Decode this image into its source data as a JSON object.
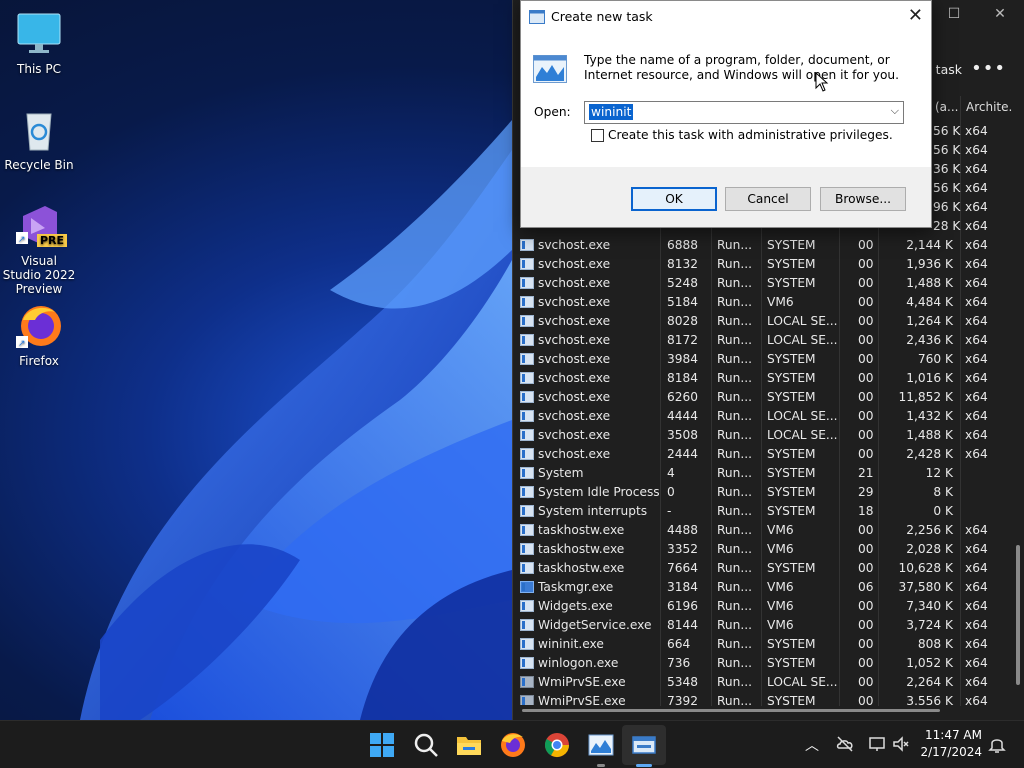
{
  "desktop": {
    "icons": [
      {
        "label": "This PC",
        "icon": "monitor-icon"
      },
      {
        "label": "Recycle Bin",
        "icon": "recycle-bin-icon"
      },
      {
        "label": "Visual Studio 2022 Preview",
        "badge": "PRE",
        "icon": "visual-studio-icon"
      },
      {
        "label": "Firefox",
        "icon": "firefox-icon"
      }
    ]
  },
  "taskmgr": {
    "run_task_label": "d task",
    "more_label": "•••",
    "columns": {
      "memory": "(a...",
      "arch": "Archite."
    },
    "partial_rows": [
      {
        "mem": "56 K",
        "arch": "x64"
      },
      {
        "mem": "56 K",
        "arch": "x64"
      },
      {
        "mem": "36 K",
        "arch": "x64"
      },
      {
        "mem": "56 K",
        "arch": "x64"
      },
      {
        "mem": "96 K",
        "arch": "x64"
      },
      {
        "mem": "28 K",
        "arch": "x64"
      }
    ],
    "rows": [
      {
        "name": "svchost.exe",
        "pid": "6888",
        "status": "Run...",
        "user": "SYSTEM",
        "cpu": "00",
        "mem": "2,144 K",
        "arch": "x64",
        "icon": "default"
      },
      {
        "name": "svchost.exe",
        "pid": "8132",
        "status": "Run...",
        "user": "SYSTEM",
        "cpu": "00",
        "mem": "1,936 K",
        "arch": "x64",
        "icon": "default"
      },
      {
        "name": "svchost.exe",
        "pid": "5248",
        "status": "Run...",
        "user": "SYSTEM",
        "cpu": "00",
        "mem": "1,488 K",
        "arch": "x64",
        "icon": "default"
      },
      {
        "name": "svchost.exe",
        "pid": "5184",
        "status": "Run...",
        "user": "VM6",
        "cpu": "00",
        "mem": "4,484 K",
        "arch": "x64",
        "icon": "default"
      },
      {
        "name": "svchost.exe",
        "pid": "8028",
        "status": "Run...",
        "user": "LOCAL SE...",
        "cpu": "00",
        "mem": "1,264 K",
        "arch": "x64",
        "icon": "default"
      },
      {
        "name": "svchost.exe",
        "pid": "8172",
        "status": "Run...",
        "user": "LOCAL SE...",
        "cpu": "00",
        "mem": "2,436 K",
        "arch": "x64",
        "icon": "default"
      },
      {
        "name": "svchost.exe",
        "pid": "3984",
        "status": "Run...",
        "user": "SYSTEM",
        "cpu": "00",
        "mem": "760 K",
        "arch": "x64",
        "icon": "default"
      },
      {
        "name": "svchost.exe",
        "pid": "8184",
        "status": "Run...",
        "user": "SYSTEM",
        "cpu": "00",
        "mem": "1,016 K",
        "arch": "x64",
        "icon": "default"
      },
      {
        "name": "svchost.exe",
        "pid": "6260",
        "status": "Run...",
        "user": "SYSTEM",
        "cpu": "00",
        "mem": "11,852 K",
        "arch": "x64",
        "icon": "default"
      },
      {
        "name": "svchost.exe",
        "pid": "4444",
        "status": "Run...",
        "user": "LOCAL SE...",
        "cpu": "00",
        "mem": "1,432 K",
        "arch": "x64",
        "icon": "default"
      },
      {
        "name": "svchost.exe",
        "pid": "3508",
        "status": "Run...",
        "user": "LOCAL SE...",
        "cpu": "00",
        "mem": "1,488 K",
        "arch": "x64",
        "icon": "default"
      },
      {
        "name": "svchost.exe",
        "pid": "2444",
        "status": "Run...",
        "user": "SYSTEM",
        "cpu": "00",
        "mem": "2,428 K",
        "arch": "x64",
        "icon": "default"
      },
      {
        "name": "System",
        "pid": "4",
        "status": "Run...",
        "user": "SYSTEM",
        "cpu": "21",
        "mem": "12 K",
        "arch": "",
        "icon": "default"
      },
      {
        "name": "System Idle Process",
        "pid": "0",
        "status": "Run...",
        "user": "SYSTEM",
        "cpu": "29",
        "mem": "8 K",
        "arch": "",
        "icon": "default"
      },
      {
        "name": "System interrupts",
        "pid": "-",
        "status": "Run...",
        "user": "SYSTEM",
        "cpu": "18",
        "mem": "0 K",
        "arch": "",
        "icon": "default"
      },
      {
        "name": "taskhostw.exe",
        "pid": "4488",
        "status": "Run...",
        "user": "VM6",
        "cpu": "00",
        "mem": "2,256 K",
        "arch": "x64",
        "icon": "default"
      },
      {
        "name": "taskhostw.exe",
        "pid": "3352",
        "status": "Run...",
        "user": "VM6",
        "cpu": "00",
        "mem": "2,028 K",
        "arch": "x64",
        "icon": "default"
      },
      {
        "name": "taskhostw.exe",
        "pid": "7664",
        "status": "Run...",
        "user": "SYSTEM",
        "cpu": "00",
        "mem": "10,628 K",
        "arch": "x64",
        "icon": "default"
      },
      {
        "name": "Taskmgr.exe",
        "pid": "3184",
        "status": "Run...",
        "user": "VM6",
        "cpu": "06",
        "mem": "37,580 K",
        "arch": "x64",
        "icon": "tm"
      },
      {
        "name": "Widgets.exe",
        "pid": "6196",
        "status": "Run...",
        "user": "VM6",
        "cpu": "00",
        "mem": "7,340 K",
        "arch": "x64",
        "icon": "default"
      },
      {
        "name": "WidgetService.exe",
        "pid": "8144",
        "status": "Run...",
        "user": "VM6",
        "cpu": "00",
        "mem": "3,724 K",
        "arch": "x64",
        "icon": "default"
      },
      {
        "name": "wininit.exe",
        "pid": "664",
        "status": "Run...",
        "user": "SYSTEM",
        "cpu": "00",
        "mem": "808 K",
        "arch": "x64",
        "icon": "default"
      },
      {
        "name": "winlogon.exe",
        "pid": "736",
        "status": "Run...",
        "user": "SYSTEM",
        "cpu": "00",
        "mem": "1,052 K",
        "arch": "x64",
        "icon": "default"
      },
      {
        "name": "WmiPrvSE.exe",
        "pid": "5348",
        "status": "Run...",
        "user": "LOCAL SE...",
        "cpu": "00",
        "mem": "2,264 K",
        "arch": "x64",
        "icon": "gear"
      },
      {
        "name": "WmiPrvSE.exe",
        "pid": "7392",
        "status": "Run...",
        "user": "SYSTEM",
        "cpu": "00",
        "mem": "3,556 K",
        "arch": "x64",
        "icon": "gear"
      }
    ]
  },
  "dialog": {
    "title": "Create new task",
    "message": "Type the name of a program, folder, document, or Internet resource, and Windows will open it for you.",
    "open_label": "Open:",
    "open_value": "wininit",
    "admin_label": "Create this task with administrative privileges.",
    "admin_checked": false,
    "ok_label": "OK",
    "cancel_label": "Cancel",
    "browse_label": "Browse..."
  },
  "taskbar": {
    "clock_time": "11:47 AM",
    "clock_date": "2/17/2024",
    "apps": [
      "start-icon",
      "search-icon",
      "file-explorer-icon",
      "firefox-icon",
      "chrome-icon",
      "task-manager-icon",
      "run-dialog-icon"
    ]
  },
  "colors": {
    "accent": "#0a64cf",
    "taskbar": "#1c1c1c",
    "taskmgr_bg": "#1f1f1f"
  }
}
